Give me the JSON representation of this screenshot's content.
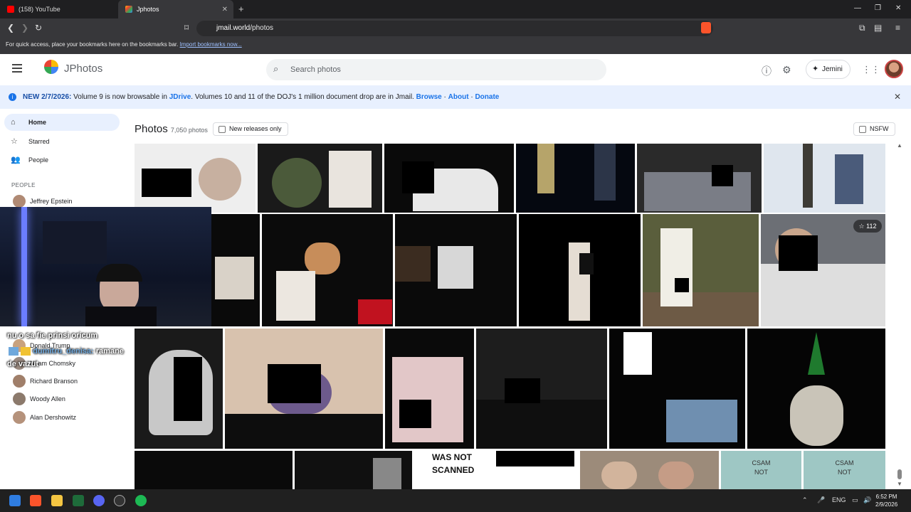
{
  "browser": {
    "tabs": [
      {
        "label": "(158) YouTube",
        "icon": "youtube-icon"
      },
      {
        "label": "Jphotos",
        "icon": "jphotos-icon"
      }
    ],
    "url_host": "jmail.world",
    "url_path": "/photos",
    "bookmarks_text": "For quick access, place your bookmarks here on the bookmarks bar.",
    "bookmarks_link": "Import bookmarks now..."
  },
  "header": {
    "brand": "JPhotos",
    "search_placeholder": "Search photos",
    "assistant_label": "Jemini"
  },
  "banner": {
    "new_label": "NEW 2/7/2026:",
    "text_a": "Volume 9 is now browsable in",
    "jdrive": "JDrive",
    "text_b": ". Volumes 10 and 11 of the DOJ's 1 million document drop are in Jmail.",
    "browse": "Browse",
    "about": "About",
    "donate": "Donate"
  },
  "sidebar": {
    "items": [
      {
        "label": "Home",
        "icon": "home-icon"
      },
      {
        "label": "Starred",
        "icon": "star-icon"
      },
      {
        "label": "People",
        "icon": "people-icon"
      }
    ],
    "people_heading": "PEOPLE",
    "people": [
      {
        "name": "Jeffrey Epstein"
      },
      {
        "name": "Donald Trump"
      },
      {
        "name": "Noam Chomsky"
      },
      {
        "name": "Richard Branson"
      },
      {
        "name": "Woody Allen"
      },
      {
        "name": "Alan Dershowitz"
      }
    ]
  },
  "main": {
    "title": "Photos",
    "count": "7,050 photos",
    "new_releases": "New releases only",
    "nsfw": "NSFW",
    "star_count": "112",
    "row4": {
      "scanned_a": "WAS NOT",
      "scanned_b": "SCANNED",
      "csam_a": "CSAM",
      "csam_b": "NOT"
    }
  },
  "stream_chat": {
    "line1": "nu o sa fie prinsi oricum",
    "line2_user": "dumitru_denisa:",
    "line2_text": "ramane",
    "line3": "de vazut"
  },
  "taskbar": {
    "lang": "ENG",
    "time": "6:52 PM",
    "date": "2/9/2026"
  }
}
